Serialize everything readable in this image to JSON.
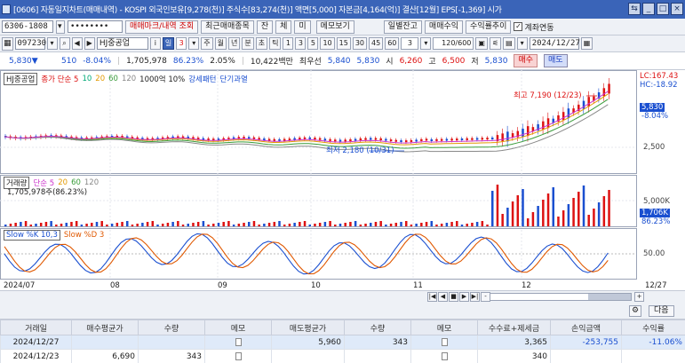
{
  "window": {
    "title": "[0606] 자동일지차트(매매내역) - KOSPI 외국인보유[9,278(천)] 주식수[83,274(천)] 액면[5,000] 자본금[4,164(억)] 결산[12월] EPS[-1,369] 시가",
    "min_label": "_",
    "max_label": "□",
    "close_label": "×",
    "extra_label": "⇆"
  },
  "toolbar1": {
    "account": "6306-1808",
    "password": "••••••••",
    "btn_trade_mark": "매매마크/내역 조회",
    "btn_recent": "최근매매종목",
    "btn_jan": "잔",
    "btn_che": "체",
    "btn_mi": "미",
    "btn_memo": "메모보기",
    "btn_daily": "일별잔고",
    "btn_profit": "매매수익",
    "btn_trend": "수익률추이",
    "chk_account": "계좌연동",
    "chk_state": "✓"
  },
  "toolbar2": {
    "code": "097230",
    "stock_name": "HJ중공업",
    "period_day": "일",
    "period_num": "3",
    "periods": [
      "주",
      "월",
      "년",
      "분",
      "초",
      "틱"
    ],
    "minutes": [
      "1",
      "3",
      "5",
      "10",
      "15",
      "30",
      "45",
      "60"
    ],
    "minute_sel": "3",
    "count": "120/600",
    "date": "2024/12/27"
  },
  "quote": {
    "price": "5,830▼",
    "change": "510",
    "pct": "-8.04%",
    "volume": "1,705,978",
    "vol_pct": "86.23%",
    "turnover": "2.05%",
    "amount": "10,422백만",
    "label_best_sell": "최우선",
    "best_ask": "5,840",
    "best_bid": "5,830",
    "open_label": "시",
    "open": "6,260",
    "high_label": "고",
    "high": "6,500",
    "low_label": "저",
    "low": "5,830",
    "buy": "매수",
    "sell": "매도"
  },
  "price_panel": {
    "legend_name": "HJ중공업",
    "legend_ma": "종가 단순 5",
    "ma_periods": [
      "10",
      "20",
      "60",
      "120"
    ],
    "unit": "1000억 10%",
    "extra1": "강세패턴",
    "extra2": "단기과열",
    "high_note": "최고 7,190 (12/23)",
    "low_note": "최저 2,180 (10/31)",
    "lc": "LC:167.43",
    "hc": "HC:-18.92",
    "price_tag": "5,830",
    "pct_tag": "-8.04%",
    "tick_2500": "2,500"
  },
  "volume_panel": {
    "legend_name": "거래량",
    "legend_ma": "단순 5",
    "ma_periods": [
      "20",
      "60",
      "120"
    ],
    "value": "1,705,978주(86.23%)",
    "tick_5000k": "5,000K",
    "tag_vol": "1,706K",
    "tag_pct": "86.23%"
  },
  "stoch_panel": {
    "legend_k": "Slow %K 10,3",
    "legend_d": "Slow %D 3",
    "tick_50": "50.00"
  },
  "xaxis": [
    "2024/07",
    "08",
    "09",
    "10",
    "11",
    "12",
    "12/27"
  ],
  "scroll": {
    "buttons": [
      "|◀",
      "◀",
      "■",
      "▶",
      "▶|",
      "-",
      "+"
    ]
  },
  "bottom": {
    "gear": "⚙",
    "next": "다음"
  },
  "table": {
    "headers": [
      "거래일",
      "매수평균가",
      "수량",
      "메모",
      "매도평균가",
      "수량",
      "메모",
      "수수료+제세금",
      "손익금액",
      "수익률"
    ],
    "rows": [
      [
        "2024/12/27",
        "",
        "",
        "",
        "5,960",
        "343",
        "",
        "3,365",
        "-253,755",
        "-11.06%"
      ],
      [
        "2024/12/23",
        "6,690",
        "343",
        "",
        "",
        "",
        "",
        "340",
        "",
        ""
      ]
    ]
  },
  "colors": {
    "accent": "#3a64b8",
    "up": "#dd1111",
    "down": "#1a4fd0"
  }
}
